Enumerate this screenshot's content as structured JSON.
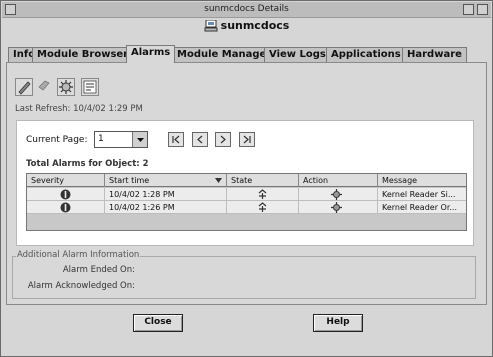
{
  "window": {
    "title": "sunmcdocs Details",
    "header": "sunmcdocs"
  },
  "tabs": [
    {
      "label": "Info"
    },
    {
      "label": "Module Browser"
    },
    {
      "label": "Alarms"
    },
    {
      "label": "Module Manager"
    },
    {
      "label": "View Logs"
    },
    {
      "label": "Applications"
    },
    {
      "label": "Hardware"
    }
  ],
  "active_tab": "Alarms",
  "toolbar": {
    "icons": [
      "acknowledge-icon",
      "delete-icon",
      "fix-icon",
      "filter-icon"
    ]
  },
  "last_refresh": "Last Refresh: 10/4/02 1:29 PM",
  "paging": {
    "label": "Current Page:",
    "value": "1"
  },
  "total_alarms": "Total Alarms for Object: 2",
  "table": {
    "columns": [
      "Severity",
      "Start time",
      "State",
      "Action",
      "Message"
    ],
    "rows": [
      {
        "start_time": "10/4/02 1:28 PM",
        "message": "Kernel Reader Si..."
      },
      {
        "start_time": "10/4/02 1:26 PM",
        "message": "Kernel Reader Or..."
      }
    ]
  },
  "additional_info": {
    "legend": "Additional Alarm Information",
    "ended_label": "Alarm Ended On:",
    "ack_label": "Alarm Acknowledged On:"
  },
  "buttons": {
    "close": "Close",
    "help": "Help"
  },
  "colors": {
    "background": "#d6d6d6",
    "severity": "#333333"
  }
}
